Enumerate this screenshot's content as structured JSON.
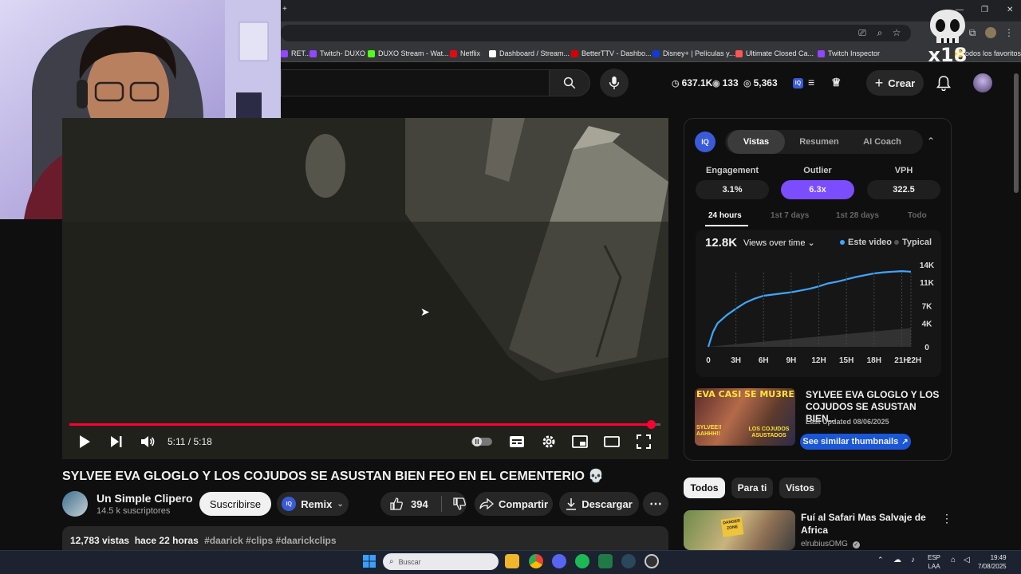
{
  "browser": {
    "bookmarks": [
      {
        "label": "RET...",
        "color": "#9146ff"
      },
      {
        "label": "Twitch- DUXO",
        "color": "#9146ff"
      },
      {
        "label": "DUXO Stream - Wat...",
        "color": "#53fc18"
      },
      {
        "label": "Netflix",
        "color": "#e50914"
      },
      {
        "label": "Dashboard / Stream...",
        "color": "#ffffff"
      },
      {
        "label": "BetterTTV - Dashbo...",
        "color": "#d50000"
      },
      {
        "label": "Disney+ | Películas y...",
        "color": "#113ccf"
      },
      {
        "label": "Ultimate Closed Ca...",
        "color": "#ff5555"
      },
      {
        "label": "Twitch Inspector",
        "color": "#9146ff"
      },
      {
        "label": "odos los favoritos",
        "color": "#fbbc04"
      }
    ]
  },
  "header": {
    "search_placeholder": "",
    "stats": {
      "views": "637.1K",
      "watching": "133",
      "count": "5,363"
    },
    "crear_label": "Crear"
  },
  "overlay_logo_text": "x18",
  "player": {
    "time": "5:11 / 5:18",
    "progress": 0.984
  },
  "video": {
    "title": "SYLVEE EVA GLOGLO Y LOS COJUDOS SE ASUSTAN BIEN FEO EN EL CEMENTERIO 💀",
    "channel_name": "Un Simple Clipero",
    "channel_subs": "14.5 k suscriptores",
    "subscribe_label": "Suscribirse",
    "remix_label": "Remix",
    "likes": "394",
    "share_label": "Compartir",
    "download_label": "Descargar",
    "views_line": "12,783 vistas  hace 22 horas",
    "hashtags": "#daarick #clips #daarickclips"
  },
  "panel": {
    "logo": "IQ",
    "tabs": [
      "Vistas",
      "Resumen",
      "AI Coach"
    ],
    "metrics": [
      {
        "label": "Engagement",
        "value": "3.1%"
      },
      {
        "label": "Outlier",
        "value": "6.3x"
      },
      {
        "label": "VPH",
        "value": "322.5"
      }
    ],
    "ranges": [
      "24 hours",
      "1st 7 days",
      "1st 28 days",
      "Todo"
    ],
    "total_views": "12.8K",
    "views_select": "Views over time",
    "legend": [
      "Este video",
      "Typical"
    ],
    "suggest_title": "SYLVEE EVA GLOGLO Y LOS COJUDOS SE ASUSTAN BIEN...",
    "suggest_updated": "Last Updated 08/06/2025",
    "similar_label": "See similar thumbnails",
    "thumb_top": "EVA CASI SE MU3RE..",
    "thumb_left": "SYLVEE!! AAHHH!!",
    "thumb_right": "LOS COJUDOS ASUSTADOS"
  },
  "chart_data": {
    "type": "area",
    "x_ticks": [
      "0",
      "3H",
      "6H",
      "9H",
      "12H",
      "15H",
      "18H",
      "21H",
      "22H"
    ],
    "y_ticks": [
      "14K",
      "11K",
      "7K",
      "4K",
      "0"
    ],
    "ylim": [
      0,
      14000
    ],
    "xlim": [
      0,
      22
    ],
    "series": [
      {
        "name": "Este video",
        "color": "#3ea6ff",
        "x": [
          0,
          0.5,
          1,
          2,
          3,
          4,
          5,
          6,
          7,
          8,
          9,
          10,
          11,
          12,
          13,
          14,
          15,
          16,
          17,
          18,
          19,
          20,
          21,
          22
        ],
        "y": [
          0,
          2500,
          4000,
          5400,
          6500,
          7500,
          8200,
          8700,
          8900,
          9100,
          9300,
          9600,
          9900,
          10300,
          10800,
          11100,
          11500,
          11900,
          12200,
          12500,
          12700,
          12800,
          12900,
          12800
        ]
      },
      {
        "name": "Typical",
        "color": "#555555",
        "x": [
          0,
          22
        ],
        "y": [
          0,
          3200
        ]
      }
    ]
  },
  "chips": [
    "Todos",
    "Para ti",
    "Vistos"
  ],
  "recommendation": {
    "title": "Fuí al Safari Mas Salvaje de Africa",
    "channel": "elrubiusOMG",
    "thumb_sign": "DANGER ZONE"
  },
  "taskbar": {
    "search_placeholder": "Buscar",
    "lang_top": "ESP",
    "lang_bottom": "LAA",
    "time": "19:49",
    "date": "7/08/2025"
  },
  "colors": {
    "accent_red": "#ff0033",
    "outlier_purple": "#7c4dff",
    "blue": "#3ea6ff"
  }
}
